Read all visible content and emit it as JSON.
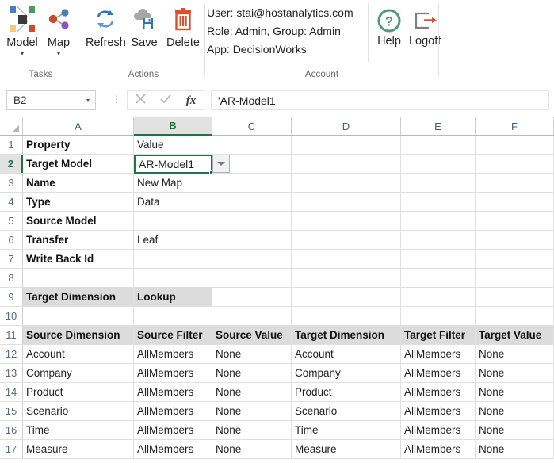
{
  "ribbon": {
    "groups": [
      {
        "name": "Tasks",
        "label": "Tasks",
        "buttons": [
          {
            "label": "Model",
            "icon": "model-network-icon",
            "caret": "▾"
          },
          {
            "label": "Map",
            "icon": "map-share-icon",
            "caret": "▾"
          }
        ]
      },
      {
        "name": "Actions",
        "label": "Actions",
        "buttons": [
          {
            "label": "Refresh",
            "icon": "refresh-icon"
          },
          {
            "label": "Save",
            "icon": "save-cloud-icon"
          },
          {
            "label": "Delete",
            "icon": "delete-trash-icon"
          }
        ]
      },
      {
        "name": "Account",
        "label": "Account",
        "info": [
          "User: stai@hostanalytics.com",
          "Role: Admin, Group: Admin",
          "App: DecisionWorks"
        ],
        "buttons": [
          {
            "label": "Help",
            "icon": "help-question-icon"
          },
          {
            "label": "Logoff",
            "icon": "logoff-exit-icon"
          }
        ]
      }
    ]
  },
  "formula_bar": {
    "name_box_value": "B2",
    "name_box_caret": "▾",
    "cancel_icon": "cancel-x-icon",
    "confirm_icon": "confirm-check-icon",
    "function_icon": "insert-function-icon",
    "function_label": "fx",
    "formula_value": "'AR-Model1"
  },
  "grid": {
    "columns": [
      {
        "label": "A",
        "selected": false
      },
      {
        "label": "B",
        "selected": true
      },
      {
        "label": "C",
        "selected": false
      },
      {
        "label": "D",
        "selected": false
      },
      {
        "label": "E",
        "selected": false
      },
      {
        "label": "F",
        "selected": false
      }
    ],
    "selected_cell": {
      "ref": "B2",
      "value": "AR-Model1",
      "dropdown_icon": "dropdown-caret-icon"
    },
    "rows": [
      {
        "num": "1",
        "selected": false,
        "style": "bold",
        "cells": [
          "Property",
          "Value",
          "",
          "",
          "",
          ""
        ]
      },
      {
        "num": "2",
        "selected": true,
        "style": "bold",
        "cells": [
          "Target Model",
          "AR-Model1",
          "",
          "",
          "",
          ""
        ]
      },
      {
        "num": "3",
        "selected": false,
        "style": "bold",
        "cells": [
          "Name",
          "New Map",
          "",
          "",
          "",
          ""
        ]
      },
      {
        "num": "4",
        "selected": false,
        "style": "bold",
        "cells": [
          "Type",
          "Data",
          "",
          "",
          "",
          ""
        ]
      },
      {
        "num": "5",
        "selected": false,
        "style": "bold",
        "cells": [
          "Source Model",
          "",
          "",
          "",
          "",
          ""
        ]
      },
      {
        "num": "6",
        "selected": false,
        "style": "bold",
        "cells": [
          "Transfer",
          "Leaf",
          "",
          "",
          "",
          ""
        ]
      },
      {
        "num": "7",
        "selected": false,
        "style": "bold",
        "cells": [
          "Write Back Id",
          "",
          "",
          "",
          "",
          ""
        ]
      },
      {
        "num": "8",
        "selected": false,
        "style": "plain",
        "cells": [
          "",
          "",
          "",
          "",
          "",
          ""
        ]
      },
      {
        "num": "9",
        "selected": false,
        "style": "shaded",
        "cells": [
          "Target Dimension",
          "Lookup",
          "",
          "",
          "",
          ""
        ]
      },
      {
        "num": "10",
        "selected": false,
        "style": "plain",
        "cells": [
          "",
          "",
          "",
          "",
          "",
          ""
        ]
      },
      {
        "num": "11",
        "selected": false,
        "style": "header",
        "cells": [
          "Source Dimension",
          "Source Filter",
          "Source Value",
          "Target Dimension",
          "Target Filter",
          "Target Value"
        ]
      },
      {
        "num": "12",
        "selected": false,
        "style": "plain",
        "cells": [
          "Account",
          "AllMembers",
          "None",
          "Account",
          "AllMembers",
          "None"
        ]
      },
      {
        "num": "13",
        "selected": false,
        "style": "plain",
        "cells": [
          "Company",
          "AllMembers",
          "None",
          "Company",
          "AllMembers",
          "None"
        ]
      },
      {
        "num": "14",
        "selected": false,
        "style": "plain",
        "cells": [
          "Product",
          "AllMembers",
          "None",
          "Product",
          "AllMembers",
          "None"
        ]
      },
      {
        "num": "15",
        "selected": false,
        "style": "plain",
        "cells": [
          "Scenario",
          "AllMembers",
          "None",
          "Scenario",
          "AllMembers",
          "None"
        ]
      },
      {
        "num": "16",
        "selected": false,
        "style": "plain",
        "cells": [
          "Time",
          "AllMembers",
          "None",
          "Time",
          "AllMembers",
          "None"
        ]
      },
      {
        "num": "17",
        "selected": false,
        "style": "plain",
        "cells": [
          "Measure",
          "AllMembers",
          "None",
          "Measure",
          "AllMembers",
          "None"
        ]
      }
    ]
  },
  "colors": {
    "excel_green": "#217346",
    "refresh_blue": "#2e75b6",
    "delete_orange": "#d9502b",
    "help_green": "#4f9b7a",
    "logoff_orange": "#d9502b",
    "header_shade": "#dcdcdc"
  }
}
